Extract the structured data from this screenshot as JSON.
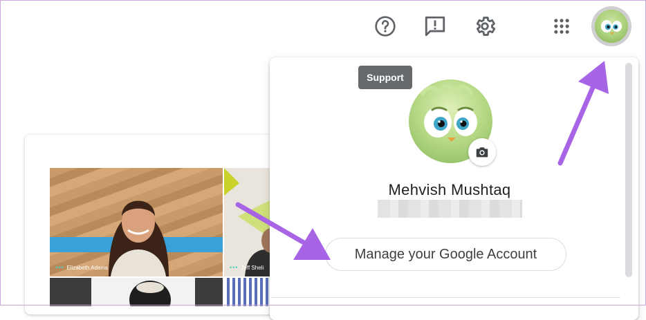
{
  "toolbar": {
    "help_icon": "help-circle-icon",
    "feedback_icon": "feedback-icon",
    "settings_icon": "gear-icon",
    "apps_icon": "apps-grid-icon",
    "account_avatar": "account-avatar"
  },
  "tooltip": {
    "label": "Support"
  },
  "account_panel": {
    "user_name": "Mehvish Mushtaq",
    "manage_button_label": "Manage your Google Account",
    "camera_icon": "camera-icon"
  },
  "meet_preview": {
    "tiles": [
      {
        "name": "Elizabeth Adams"
      },
      {
        "name": "Jeff Sheli"
      }
    ]
  },
  "colors": {
    "annotation_arrow": "#a765e6",
    "tooltip_bg": "#666a6d",
    "icon_gray": "#5f6368"
  }
}
